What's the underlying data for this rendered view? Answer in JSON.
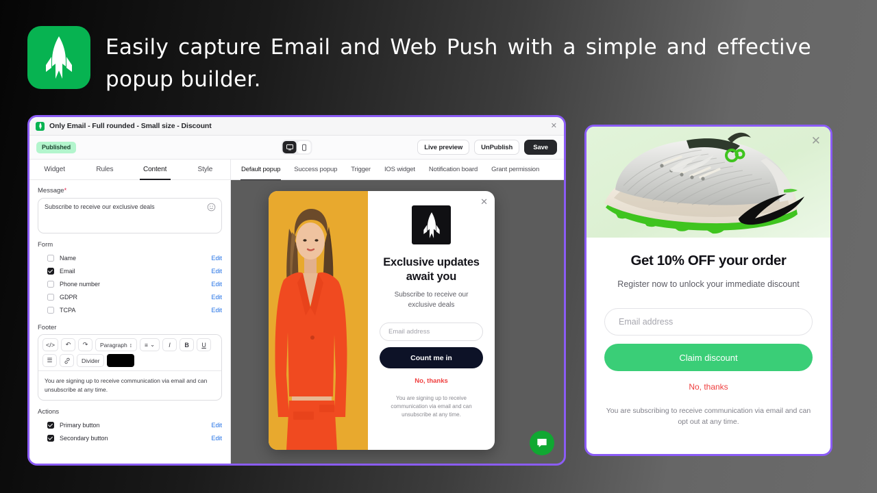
{
  "hero": {
    "headline": "Easily capture Email and Web Push with a simple and effective popup builder.",
    "logo_icon": "rocket-icon",
    "logo_color": "#07b351"
  },
  "app_window": {
    "titlebar": {
      "app_icon": "rocket-icon",
      "title": "Only Email - Full rounded - Small size - Discount",
      "close_icon": "close-icon"
    },
    "toolbar": {
      "status_badge": "Published",
      "status_badge_color": "#b3f5cd",
      "device_toggle": [
        {
          "name": "desktop-icon",
          "selected": true
        },
        {
          "name": "mobile-icon",
          "selected": false
        }
      ],
      "buttons": [
        {
          "label": "Live preview",
          "style": "secondary"
        },
        {
          "label": "UnPublish",
          "style": "secondary"
        },
        {
          "label": "Save",
          "style": "primary"
        }
      ]
    },
    "editor": {
      "subtabs": [
        {
          "label": "Widget",
          "active": false
        },
        {
          "label": "Rules",
          "active": false
        },
        {
          "label": "Content",
          "active": true
        },
        {
          "label": "Style",
          "active": false
        }
      ],
      "message": {
        "label": "Message",
        "required_marker": "*",
        "value": "Subscribe to receive our exclusive deals",
        "emoji_icon": "emoji-smiley-icon"
      },
      "form": {
        "title": "Form",
        "edit_label": "Edit",
        "fields": [
          {
            "label": "Name",
            "checked": false
          },
          {
            "label": "Email",
            "checked": true
          },
          {
            "label": "Phone number",
            "checked": false
          },
          {
            "label": "GDPR",
            "checked": false
          },
          {
            "label": "TCPA",
            "checked": false
          }
        ]
      },
      "footer": {
        "title": "Footer",
        "toolbar": [
          {
            "name": "code-icon",
            "glyph": "</>"
          },
          {
            "name": "undo-icon",
            "glyph": "↶"
          },
          {
            "name": "redo-icon",
            "glyph": "↷"
          },
          {
            "name": "paragraph-select",
            "glyph": "Paragraph"
          },
          {
            "name": "align-icon",
            "glyph": "≡"
          },
          {
            "name": "italic-icon",
            "glyph": "I"
          },
          {
            "name": "bold-icon",
            "glyph": "B"
          },
          {
            "name": "underline-icon",
            "glyph": "U"
          },
          {
            "name": "list-icon",
            "glyph": "☰"
          },
          {
            "name": "link-icon",
            "glyph": "🔗"
          },
          {
            "name": "divider-button",
            "glyph": "Divider"
          }
        ],
        "color_swatch": "#000000",
        "text": "You are signing up to receive communication via email and can unsubscribe at any time."
      },
      "actions": {
        "title": "Actions",
        "edit_label": "Edit",
        "items": [
          {
            "label": "Primary button",
            "checked": true
          },
          {
            "label": "Secondary button",
            "checked": true
          }
        ]
      }
    },
    "preview": {
      "tabs": [
        {
          "label": "Default popup",
          "active": true
        },
        {
          "label": "Success popup",
          "active": false
        },
        {
          "label": "Trigger",
          "active": false
        },
        {
          "label": "IOS widget",
          "active": false
        },
        {
          "label": "Notification board",
          "active": false
        },
        {
          "label": "Grant permission",
          "active": false
        }
      ],
      "popup": {
        "image_alt": "woman-in-orange-suit-photo",
        "close_icon": "close-icon",
        "brand_icon": "rocket-icon",
        "heading": "Exclusive updates await you",
        "subheading": "Subscribe to receive our exclusive deals",
        "email_placeholder": "Email address",
        "primary_button": "Count me in",
        "secondary_button": "No, thanks",
        "fine_print": "You are signing up to receive communication via email and can unsubscribe at any time."
      },
      "chat_fab_icon": "chat-bubble-icon"
    }
  },
  "promo_window": {
    "image_alt": "nike-sneaker-photo",
    "close_icon": "close-icon",
    "heading": "Get 10% OFF your order",
    "subheading": "Register now to unlock your immediate discount",
    "email_placeholder": "Email address",
    "primary_button": "Claim discount",
    "primary_button_color": "#3ace77",
    "secondary_button": "No, thanks",
    "secondary_button_color": "#ef3d3d",
    "fine_print": "You are subscribing to receive communication via email and can opt out at any time."
  }
}
